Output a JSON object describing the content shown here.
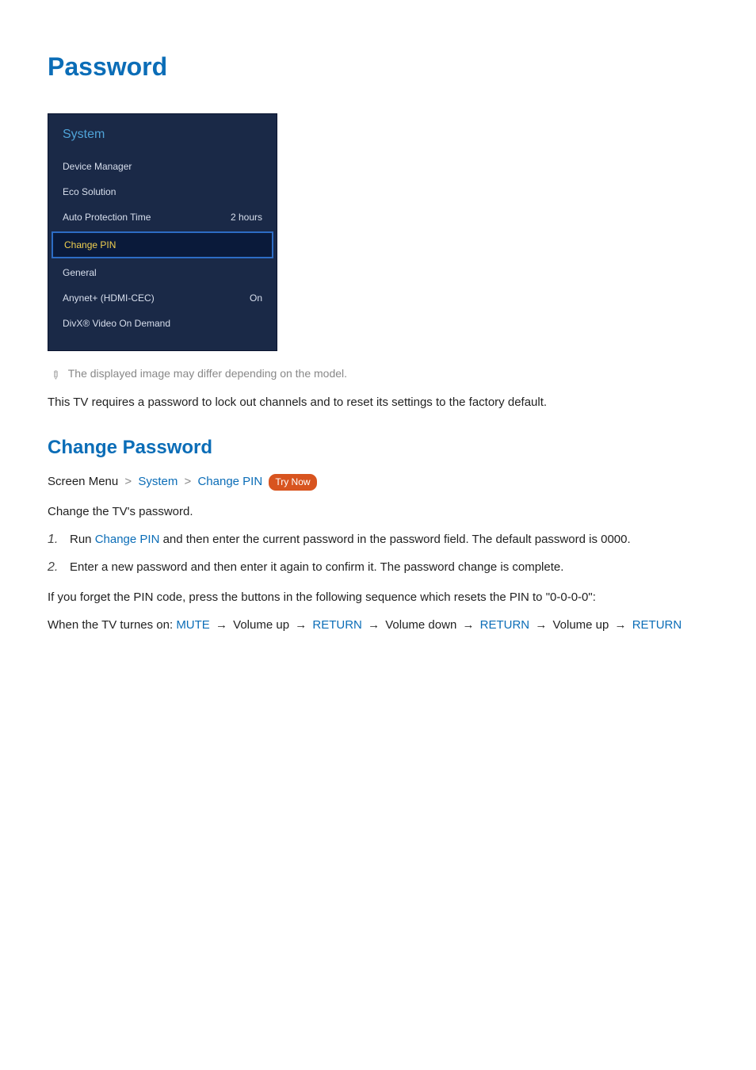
{
  "page": {
    "title": "Password"
  },
  "menu": {
    "header": "System",
    "items": [
      {
        "label": "Device Manager",
        "value": ""
      },
      {
        "label": "Eco Solution",
        "value": ""
      },
      {
        "label": "Auto Protection Time",
        "value": "2 hours"
      },
      {
        "label": "Change PIN",
        "value": "",
        "selected": true
      },
      {
        "label": "General",
        "value": ""
      },
      {
        "label": "Anynet+ (HDMI-CEC)",
        "value": "On"
      },
      {
        "label": "DivX® Video On Demand",
        "value": ""
      }
    ]
  },
  "note": {
    "text": "The displayed image may differ depending on the model."
  },
  "intro": "This TV requires a password to lock out channels and to reset its settings to the factory default.",
  "section": {
    "title": "Change Password",
    "breadcrumb": {
      "label": "Screen Menu",
      "crumb1": "System",
      "crumb2": "Change PIN",
      "try_now": "Try Now"
    },
    "lead": "Change the TV's password.",
    "steps": {
      "s1_pre": "Run ",
      "s1_link": "Change PIN",
      "s1_post": " and then enter the current password in the password field. The default password is 0000.",
      "s2": "Enter a new password and then enter it again to confirm it. The password change is complete."
    },
    "forgot": "If you forget the PIN code, press the buttons in the following sequence which resets the PIN to \"0-0-0-0\":",
    "reset_seq": {
      "prefix": "When the TV turnes on: ",
      "mute": "MUTE",
      "vol_up": "Volume up",
      "vol_down": "Volume down",
      "return": "RETURN",
      "arrow": "→"
    }
  }
}
